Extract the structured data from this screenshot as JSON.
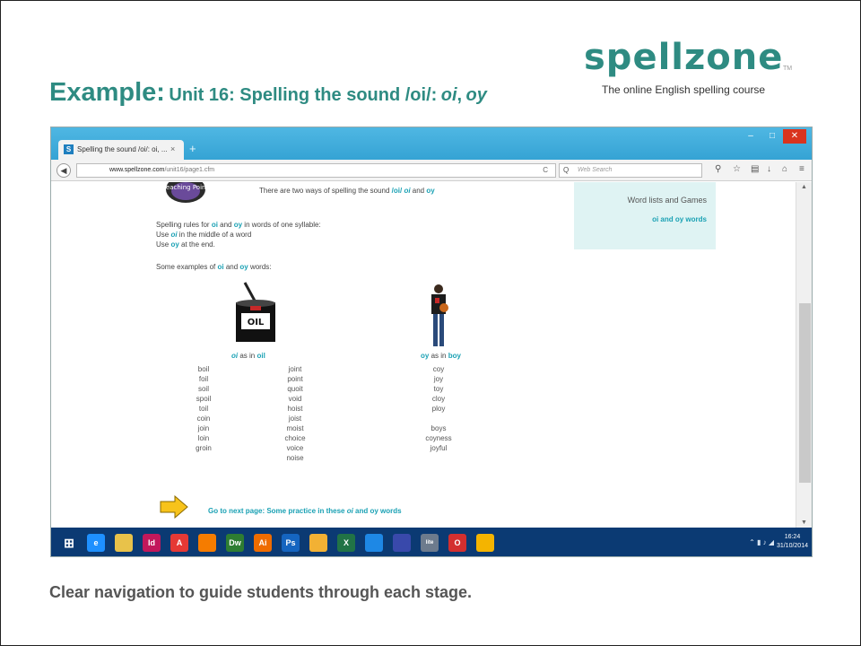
{
  "slide": {
    "title_prefix": "Example:",
    "title_main": "Unit 16: Spelling the sound /oi/:",
    "title_oi": "oi",
    "title_sep": ",",
    "title_oy": "oy",
    "caption": "Clear navigation to guide students through each stage."
  },
  "logo": {
    "word": "spellzone",
    "tm": "TM",
    "tagline": "The online English spelling course"
  },
  "browser": {
    "tab_favicon": "S",
    "tab_title": "Spelling the sound /oi/: oi, ...",
    "tab_close": "×",
    "new_tab": "+",
    "url_host": "www.spellzone.com",
    "url_path": "/unit16/page1.cfm",
    "search_placeholder": "Web Search",
    "window_close": "✕",
    "window_min": "–",
    "window_max": "□"
  },
  "page": {
    "teaching_point": "Teaching Point",
    "intro_pre": "There are two ways of spelling the sound ",
    "intro_sound": "/oi/",
    "intro_sep": " ",
    "intro_oi": "oi",
    "intro_and": " and ",
    "intro_oy": "oy",
    "rules_pre": "Spelling rules for ",
    "rules_oi": "oi",
    "rules_and": " and ",
    "rules_oy": "oy",
    "rules_post": " in words of one syllable:",
    "rule1_pre": "Use ",
    "rule1_oi": "oi",
    "rule1_post": " in the middle of a word",
    "rule2_pre": "Use ",
    "rule2_oy": "oy",
    "rule2_post": " at the end.",
    "examples_pre": "Some examples of ",
    "examples_oi": "oi",
    "examples_and": " and ",
    "examples_oy": "oy",
    "examples_post": " words:",
    "oil_can_label": "OIL",
    "oi_caption_oi": "oi",
    "oi_caption_mid": " as in ",
    "oi_caption_word": "oil",
    "oy_caption_oy": "oy",
    "oy_caption_mid": " as in ",
    "oy_caption_word": "boy",
    "oi_words_col1": [
      "boil",
      "foil",
      "soil",
      "spoil",
      "toil",
      "coin",
      "join",
      "loin",
      "groin"
    ],
    "oi_words_col2": [
      "joint",
      "point",
      "quoit",
      "void",
      "hoist",
      "joist",
      "moist",
      "choice",
      "voice",
      "noise"
    ],
    "oy_words": [
      "coy",
      "joy",
      "toy",
      "cloy",
      "ploy",
      "",
      "boys",
      "coyness",
      "joyful"
    ],
    "next_pre": "Go to next page: Some practice in these ",
    "next_oi": "oi",
    "next_and": " and ",
    "next_oy": "oy",
    "next_post": " words"
  },
  "sidebar": {
    "title": "Word lists and Games",
    "link": "oi and oy words"
  },
  "taskbar": {
    "apps": [
      {
        "icon": "ie-icon",
        "color": "#1e90ff",
        "glyph": "e"
      },
      {
        "icon": "file-explorer-icon",
        "color": "#e8c24a",
        "glyph": ""
      },
      {
        "icon": "indesign-icon",
        "color": "#c2185b",
        "glyph": "Id"
      },
      {
        "icon": "acrobat-icon",
        "color": "#e53935",
        "glyph": "A"
      },
      {
        "icon": "firefox-icon",
        "color": "#f57c00",
        "glyph": ""
      },
      {
        "icon": "dreamweaver-icon",
        "color": "#2e7d32",
        "glyph": "Dw"
      },
      {
        "icon": "illustrator-icon",
        "color": "#ef6c00",
        "glyph": "Ai"
      },
      {
        "icon": "photoshop-icon",
        "color": "#1565c0",
        "glyph": "Ps"
      },
      {
        "icon": "outlook-icon",
        "color": "#f2b134",
        "glyph": ""
      },
      {
        "icon": "excel-icon",
        "color": "#217346",
        "glyph": "X"
      },
      {
        "icon": "publisher-icon",
        "color": "#1e88e5",
        "glyph": ""
      },
      {
        "icon": "pen-icon",
        "color": "#3949ab",
        "glyph": ""
      },
      {
        "icon": "lite-icon",
        "color": "#6d7b8d",
        "glyph": "lite"
      },
      {
        "icon": "opera-icon",
        "color": "#d32f2f",
        "glyph": "O"
      },
      {
        "icon": "chrome-icon",
        "color": "#f4b400",
        "glyph": ""
      }
    ],
    "time": "16:24",
    "date": "31/10/2014"
  },
  "colors": {
    "title_teal": "#2e8b82",
    "link_teal": "#1aa1b4",
    "taskbar_blue": "#0b3a73",
    "titlebar_blue": "#3aa8d8"
  }
}
